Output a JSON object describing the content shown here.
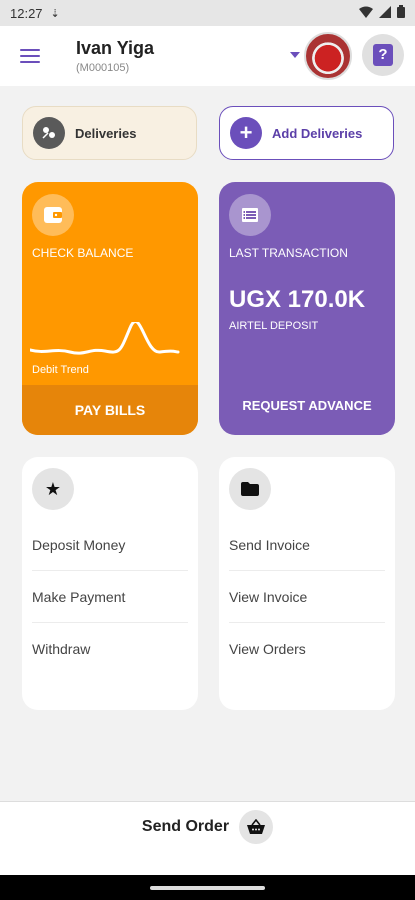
{
  "status_bar": {
    "time": "12:27"
  },
  "header": {
    "user_name": "Ivan Yiga",
    "user_id": "(M000105)"
  },
  "deliveries": {
    "left_label": "Deliveries",
    "right_label": "Add Deliveries"
  },
  "balance_card": {
    "title": "CHECK BALANCE",
    "trend_label": "Debit Trend",
    "action": "PAY BILLS",
    "color": "#ff9800"
  },
  "transaction_card": {
    "title": "LAST TRANSACTION",
    "amount": "UGX 170.0K",
    "type": "AIRTEL DEPOSIT",
    "action": "REQUEST ADVANCE",
    "color": "#7b5cb6"
  },
  "menu_left": {
    "icon": "star-icon",
    "items": [
      "Deposit Money",
      "Make Payment",
      "Withdraw"
    ]
  },
  "menu_right": {
    "icon": "folder-icon",
    "items": [
      "Send Invoice",
      "View Invoice",
      "View Orders"
    ]
  },
  "bottom": {
    "label": "Send Order"
  }
}
